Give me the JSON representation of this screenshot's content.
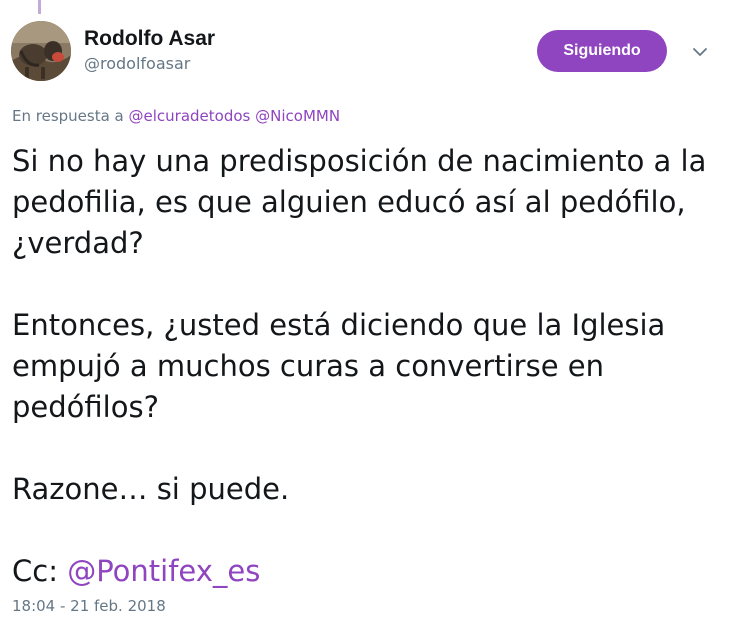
{
  "tweet": {
    "author": {
      "display_name": "Rodolfo Asar",
      "handle": "@rodolfoasar"
    },
    "follow_button_label": "Siguiendo",
    "caret_icon": "chevron-down-icon",
    "reply_to": {
      "prefix": "En respuesta a",
      "mentions": [
        "@elcuradetodos",
        "@NicoMMN"
      ]
    },
    "paragraphs": [
      "Si no hay una predisposición de nacimiento a la pedofilia, es que alguien educó así al pedófilo, ¿verdad?",
      "Entonces, ¿usted está diciendo que la Iglesia empujó a muchos curas a convertirse en pedófilos?",
      "Razone… si puede."
    ],
    "cc": {
      "prefix": "Cc:",
      "mention": "@Pontifex_es"
    },
    "timestamp": "18:04 - 21 feb. 2018"
  },
  "colors": {
    "accent": "#8f44c0",
    "text": "#14171a",
    "secondary_text": "#657786",
    "thread_line": "#c3aad8"
  }
}
